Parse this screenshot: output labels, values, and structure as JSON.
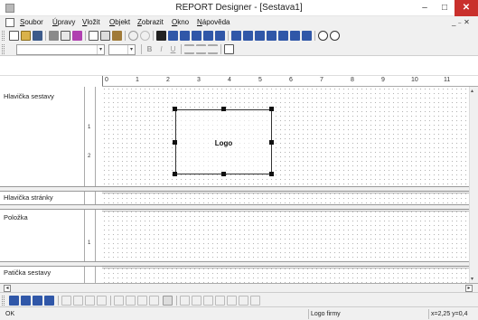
{
  "window": {
    "title": "REPORT Designer - [Sestava1]",
    "min_glyph": "–",
    "max_glyph": "□",
    "close_glyph": "✕"
  },
  "menubar": {
    "items": [
      {
        "label": "Soubor"
      },
      {
        "label": "Úpravy"
      },
      {
        "label": "Vložit"
      },
      {
        "label": "Objekt"
      },
      {
        "label": "Zobrazit"
      },
      {
        "label": "Okno"
      },
      {
        "label": "Nápověda"
      }
    ],
    "mdi_controls": "_ ₋ ✕"
  },
  "format_toolbar": {
    "bold": "B",
    "italic": "I",
    "underline": "U"
  },
  "ruler": {
    "ticks": [
      "0",
      "1",
      "2",
      "3",
      "4",
      "5",
      "6",
      "7",
      "8",
      "9",
      "10",
      "11"
    ]
  },
  "bands": [
    {
      "label": "Hlavička sestavy",
      "vticks": [
        "1",
        "2"
      ]
    },
    {
      "label": "Hlavička stránky",
      "vticks": []
    },
    {
      "label": "Položka",
      "vticks": [
        "1"
      ]
    },
    {
      "label": "Patička sestavy",
      "vticks": []
    }
  ],
  "logo_element": {
    "label": "Logo"
  },
  "scroll": {
    "left": "◂",
    "right": "▸",
    "up": "▴",
    "down": "▾"
  },
  "statusbar": {
    "status": "OK",
    "object": "Logo firmy",
    "coords": "x=2,25  y=0,4"
  },
  "colors": {
    "close_button": "#c9302c",
    "chrome": "#f0f0f0",
    "grid_dot": "#b4b4b4"
  },
  "icons": {
    "toolbar_1": [
      "new-icon",
      "open-icon",
      "save-icon",
      "print-icon",
      "print-preview-icon",
      "wizard-icon",
      "cut-icon",
      "copy-icon",
      "paste-icon",
      "undo-icon",
      "redo-icon",
      "pointer-icon",
      "text-field-icon",
      "db-field-icon",
      "sum-icon",
      "formula-icon",
      "line-icon",
      "picture-icon",
      "rectangle-icon",
      "barcode-icon",
      "checkbox-icon",
      "chart-icon",
      "subreport-icon",
      "zoom-in-icon",
      "zoom-out-icon"
    ],
    "toolbar_bottom": [
      "align-left-icon",
      "align-center-icon",
      "align-right-icon",
      "align-top-icon"
    ]
  }
}
